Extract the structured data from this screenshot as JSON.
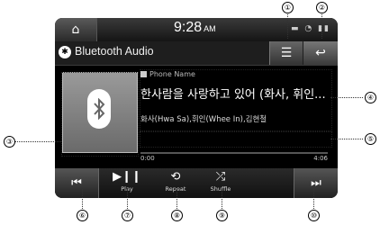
{
  "status": {
    "time": "9:28",
    "ampm": "AM",
    "indicators": "▬ ◔ ▮▮"
  },
  "header": {
    "title": "Bluetooth Audio",
    "bt_glyph": "✱"
  },
  "buttons": {
    "home": "⌂",
    "menu": "☰",
    "back": "↩",
    "prev": "⏮",
    "next": "⏭"
  },
  "track": {
    "phone_name": "Phone Name",
    "song": "한사람을 사랑하고 있어 (화사, 휘인...",
    "artist": "화사(Hwa Sa),휘인(Whee In),김현철",
    "elapsed": "0:00",
    "duration": "4:06",
    "progress": 0
  },
  "controls": {
    "play": {
      "glyph": "▶❙❙",
      "label": "Play"
    },
    "repeat": {
      "glyph": "⟲",
      "label": "Repeat"
    },
    "shuffle": {
      "glyph": "⤮",
      "label": "Shuffle"
    }
  },
  "callouts": [
    "①",
    "②",
    "③",
    "④",
    "⑤",
    "⑥",
    "⑦",
    "⑧",
    "⑨",
    "⑩"
  ]
}
